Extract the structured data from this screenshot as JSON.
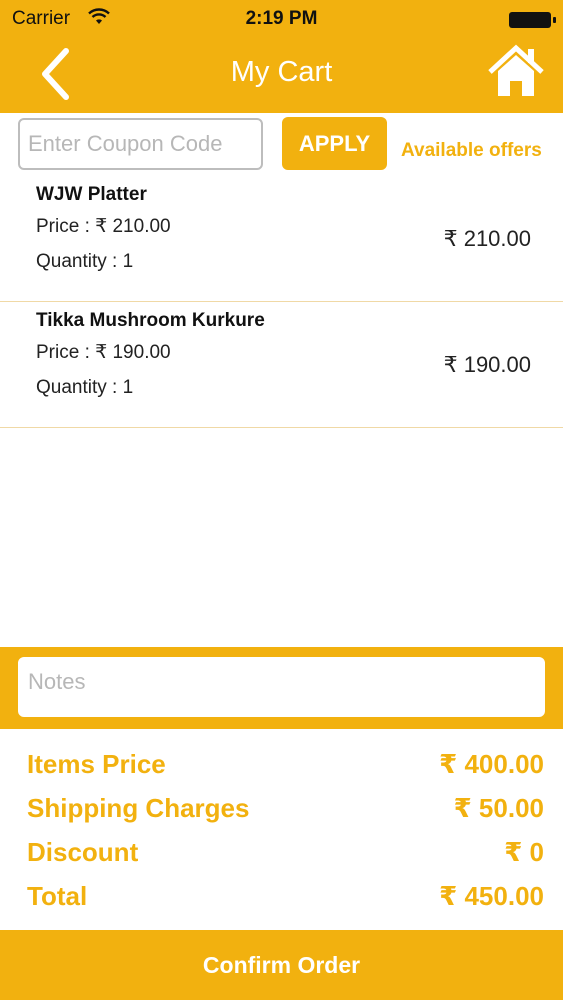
{
  "status_bar": {
    "carrier": "Carrier",
    "time": "2:19 PM"
  },
  "header": {
    "title": "My Cart",
    "back_icon": "chevron-left-icon",
    "home_icon": "home-icon"
  },
  "coupon": {
    "placeholder": "Enter Coupon Code",
    "apply_label": "APPLY",
    "offers_label": "Available offers"
  },
  "cart": {
    "items": [
      {
        "name": "WJW Platter",
        "price": "Price : ₹ 210.00",
        "quantity": "Quantity : 1",
        "total": "₹ 210.00"
      },
      {
        "name": "Tikka Mushroom Kurkure",
        "price": "Price : ₹ 190.00",
        "quantity": "Quantity : 1",
        "total": "₹ 190.00"
      }
    ]
  },
  "notes": {
    "placeholder": "Notes"
  },
  "summary": {
    "items_price_label": "Items Price",
    "items_price_value": "₹ 400.00",
    "shipping_label": "Shipping Charges",
    "shipping_value": "₹ 50.00",
    "discount_label": "Discount",
    "discount_value": "₹ 0",
    "total_label": "Total",
    "total_value": "₹ 450.00"
  },
  "footer": {
    "confirm_label": "Confirm Order"
  },
  "colors": {
    "accent": "#F2B10F",
    "divider": "#f0d9a6"
  }
}
